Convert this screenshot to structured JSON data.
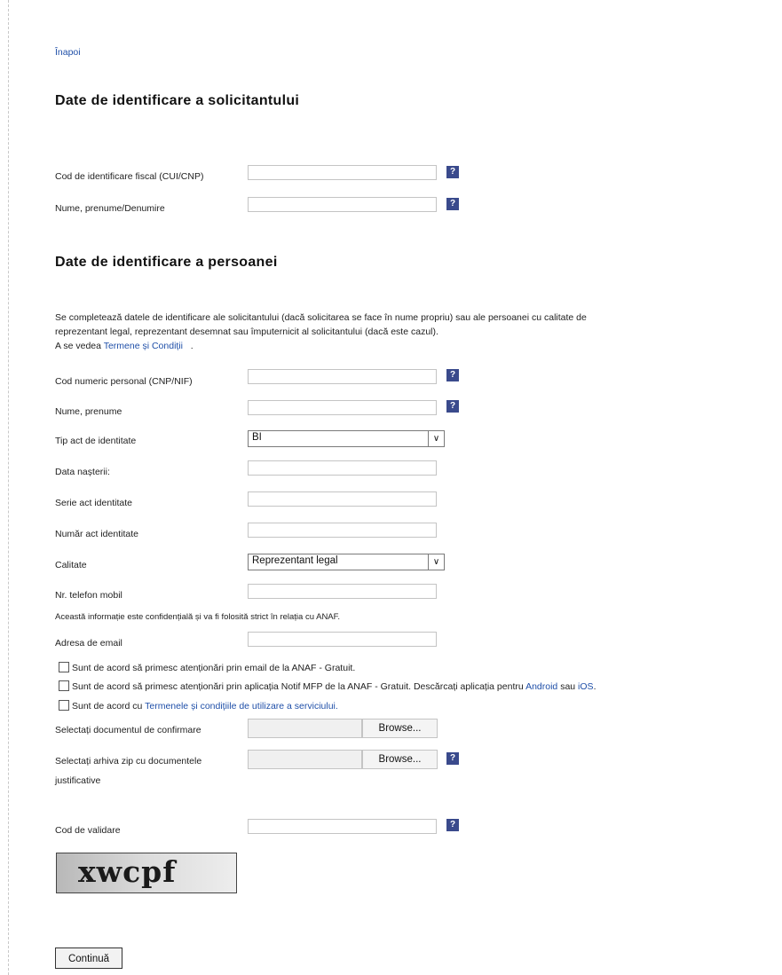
{
  "nav": {
    "back_label": "Înapoi"
  },
  "section1": {
    "title": "Date de identificare a solicitantului",
    "fields": [
      {
        "label": "Cod de identificare fiscal (CUI/CNP)",
        "value": ""
      },
      {
        "label": "Nume, prenume/Denumire",
        "value": ""
      }
    ]
  },
  "section2": {
    "title": "Date de identificare a persoanei",
    "intro_line1": "Se completează datele de identificare ale solicitantului (dacă solicitarea se face în nume propriu) sau ale persoanei cu calitate de",
    "intro_line2": "reprezentant legal, reprezentant desemnat sau împuternicit al solicitantului (dacă este cazul).",
    "see_prefix": "A se vedea",
    "terms_link": "Termene și Condiții",
    "see_suffix": ".",
    "cnp_label": "Cod numeric personal (CNP/NIF)",
    "name_label": "Nume, prenume",
    "id_type_label": "Tip act de identitate",
    "id_type_value": "BI",
    "birth_label": "Data nașterii:",
    "series_label": "Serie act identitate",
    "number_label": "Număr act identitate",
    "role_label": "Calitate",
    "role_value": "Reprezentant legal",
    "phone_label": "Nr. telefon mobil",
    "phone_note": "Această informație este confidențială și va fi folosită strict în relația cu ANAF.",
    "email_label": "Adresa de email"
  },
  "consents": {
    "email_alerts": "Sunt de acord să primesc atenționări prin email de la ANAF - Gratuit.",
    "app_alerts": "Sunt de acord să primesc atenționări prin aplicația Notif MFP de la ANAF - Gratuit. Descărcați aplicația pentru",
    "android_link": "Android",
    "or_word": "sau",
    "ios_link": "iOS",
    "ios_suffix": ".",
    "terms_prefix": "Sunt de acord cu",
    "terms_link": "Termenele și condițiile de utilizare a serviciului."
  },
  "uploads": {
    "confirm_label": "Selectați documentul de confirmare",
    "zip_label_line1": "Selectați arhiva zip cu documentele",
    "zip_label_line2": "justificative",
    "browse_label": "Browse..."
  },
  "validation": {
    "label": "Cod de validare",
    "captcha_text": "xwcpf"
  },
  "help_symbol": "?",
  "submit_label": "Continuă"
}
